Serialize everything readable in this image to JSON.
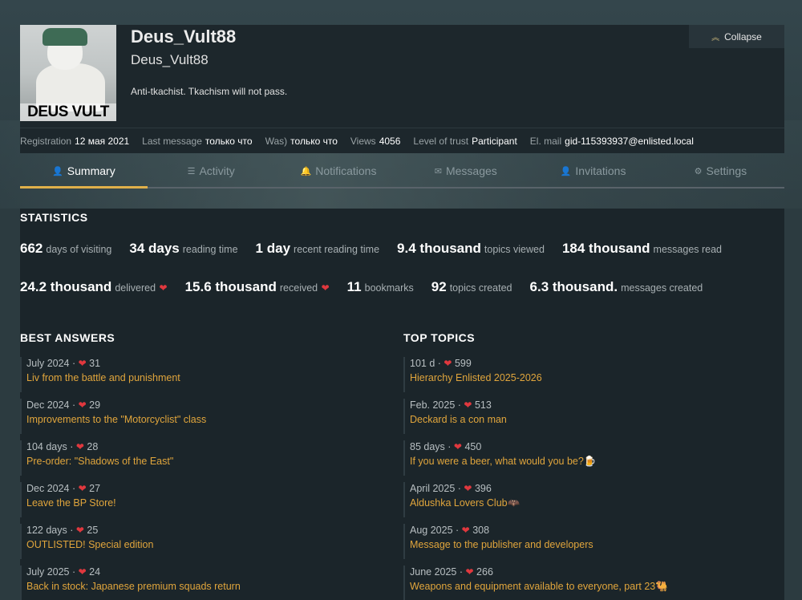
{
  "profile": {
    "username": "Deus_Vult88",
    "full_name": "Deus_Vult88",
    "bio": "Anti-tkachist. Tkachism will not pass.",
    "avatar_text": "DEUS VULT",
    "collapse_label": "Collapse"
  },
  "meta": [
    {
      "label": "Registration",
      "value": "12 мая 2021"
    },
    {
      "label": "Last message",
      "value": "только что"
    },
    {
      "label": "Was)",
      "value": "только что"
    },
    {
      "label": "Views",
      "value": "4056"
    },
    {
      "label": "Level of trust",
      "value": "Participant"
    },
    {
      "label": "El. mail",
      "value": "gid-115393937@enlisted.local"
    }
  ],
  "tabs": [
    {
      "label": "Summary",
      "icon": "user-icon",
      "active": true
    },
    {
      "label": "Activity",
      "icon": "list-icon",
      "active": false
    },
    {
      "label": "Notifications",
      "icon": "bell-icon",
      "active": false
    },
    {
      "label": "Messages",
      "icon": "envelope-icon",
      "active": false
    },
    {
      "label": "Invitations",
      "icon": "user-plus-icon",
      "active": false
    },
    {
      "label": "Settings",
      "icon": "gear-icon",
      "active": false
    }
  ],
  "statistics": {
    "title": "STATISTICS",
    "row1": [
      {
        "num": "662",
        "text": "days of visiting"
      },
      {
        "num": "34 days",
        "text": "reading time"
      },
      {
        "num": "1 day",
        "text": "recent reading time"
      },
      {
        "num": "9.4 thousand",
        "text": "topics viewed"
      },
      {
        "num": "184 thousand",
        "text": "messages read"
      }
    ],
    "row2": [
      {
        "num": "24.2 thousand",
        "text": "delivered"
      },
      {
        "num": "15.6 thousand",
        "text": "received"
      },
      {
        "num": "11",
        "text": "bookmarks"
      },
      {
        "num": "92",
        "text": "topics created"
      },
      {
        "num": "6.3 thousand.",
        "text": "messages created"
      }
    ]
  },
  "best_answers": {
    "title": "BEST ANSWERS",
    "items": [
      {
        "date": "July 2024",
        "likes": "31",
        "title": "Liv from the battle and punishment"
      },
      {
        "date": "Dec 2024",
        "likes": "29",
        "title": "Improvements to the \"Motorcyclist\" class"
      },
      {
        "date": "104 days",
        "likes": "28",
        "title": "Pre-order: \"Shadows of the East\""
      },
      {
        "date": "Dec 2024",
        "likes": "27",
        "title": "Leave the BP Store!"
      },
      {
        "date": "122 days",
        "likes": "25",
        "title": "OUTLISTED! Special edition"
      },
      {
        "date": "July 2025",
        "likes": "24",
        "title": "Back in stock: Japanese premium squads return"
      }
    ]
  },
  "top_topics": {
    "title": "TOP TOPICS",
    "items": [
      {
        "date": "101 d",
        "likes": "599",
        "title": "Hierarchy Enlisted 2025-2026"
      },
      {
        "date": "Feb. 2025",
        "likes": "513",
        "title": "Deckard is a con man"
      },
      {
        "date": "85 days",
        "likes": "450",
        "title": "If you were a beer, what would you be?🍺"
      },
      {
        "date": "April 2025",
        "likes": "396",
        "title": "Aldushka Lovers Club🦇"
      },
      {
        "date": "Aug 2025",
        "likes": "308",
        "title": "Message to the publisher and developers"
      },
      {
        "date": "June 2025",
        "likes": "266",
        "title": "Weapons and equipment available to everyone, part 23🐫"
      }
    ]
  },
  "colors": {
    "accent": "#e0b04a",
    "link": "#e0a53c",
    "heart": "#e0383e"
  }
}
